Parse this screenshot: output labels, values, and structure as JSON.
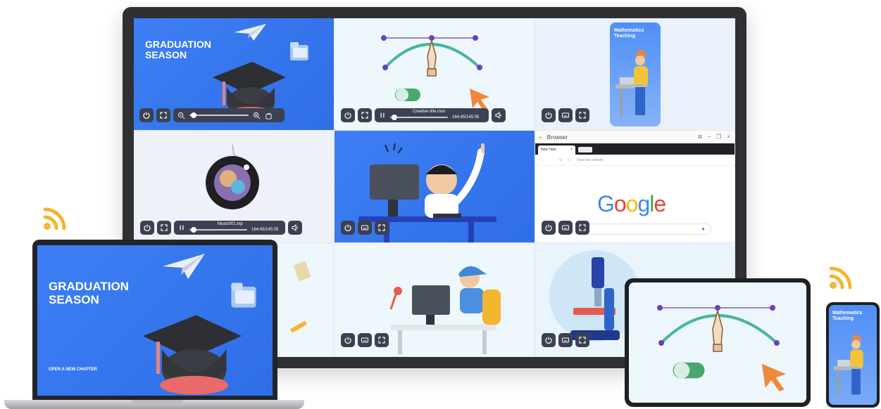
{
  "tiles": {
    "graduation": {
      "title_line1": "GRADUATION",
      "title_line2": "SEASON"
    },
    "video": {
      "filename": "Creative title.mov",
      "time": "164:45/145:05"
    },
    "mathematics": {
      "title_line1": "Mathematics",
      "title_line2": "Teaching"
    },
    "music": {
      "filename": "Music001.mp",
      "time": "164:45/145:05"
    },
    "browser": {
      "app_title": "Browser",
      "tab_label": "New Tabs",
      "url_placeholder": "Input the website",
      "logo_text": "Google"
    }
  },
  "laptop": {
    "title_line1": "GRADUATION",
    "title_line2": "SEASON",
    "subtitle": "OPEN A NEW CHAPTER"
  },
  "phone": {
    "title_line1": "Mathematics",
    "title_line2": "Teaching"
  },
  "colors": {
    "accent_blue": "#3d7ff5",
    "wifi_yellow": "#f2b630",
    "control_dark": "#3b4150"
  },
  "icons": [
    "power-icon",
    "fullscreen-icon",
    "zoom-out-icon",
    "zoom-in-icon",
    "rotate-icon",
    "pause-icon",
    "volume-icon",
    "keyboard-icon",
    "back-icon",
    "wifi-icon",
    "mic-icon",
    "refresh-icon",
    "graduation-cap-icon",
    "paper-plane-icon",
    "cursor-arrow-icon",
    "microscope-icon"
  ]
}
